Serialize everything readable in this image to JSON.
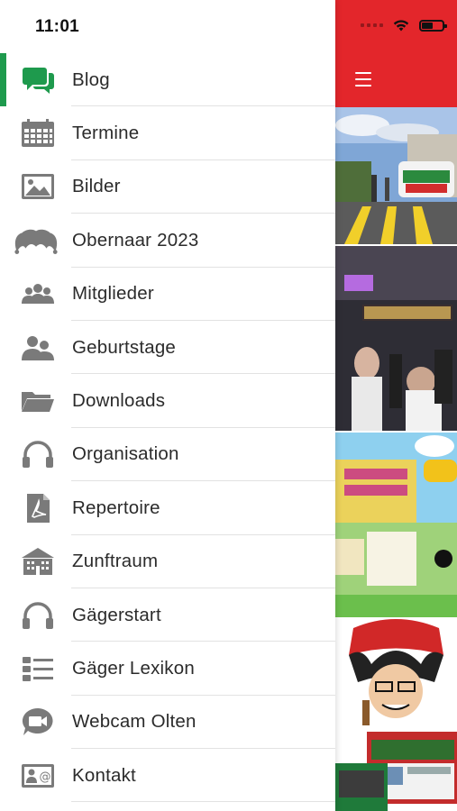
{
  "status_bar": {
    "time": "11:01"
  },
  "colors": {
    "accent_green": "#1e9a4d",
    "header_red": "#e3262b",
    "icon_gray": "#7a7a7a"
  },
  "menu": {
    "items": [
      {
        "label": "Blog",
        "icon": "chat-bubbles-icon",
        "active": true
      },
      {
        "label": "Termine",
        "icon": "calendar-icon"
      },
      {
        "label": "Bilder",
        "icon": "picture-icon"
      },
      {
        "label": "Obernaar 2023",
        "icon": "jester-hat-icon"
      },
      {
        "label": "Mitglieder",
        "icon": "group-icon"
      },
      {
        "label": "Geburtstage",
        "icon": "two-persons-icon"
      },
      {
        "label": "Downloads",
        "icon": "folder-icon"
      },
      {
        "label": "Organisation",
        "icon": "headphones-icon"
      },
      {
        "label": "Repertoire",
        "icon": "pdf-icon"
      },
      {
        "label": "Zunftraum",
        "icon": "building-icon"
      },
      {
        "label": "Gägerstart",
        "icon": "headphones-icon"
      },
      {
        "label": "Gäger Lexikon",
        "icon": "list-icon"
      },
      {
        "label": "Webcam Olten",
        "icon": "video-camera-icon"
      },
      {
        "label": "Kontakt",
        "icon": "contact-card-icon"
      }
    ]
  },
  "background_content": {
    "header_icon": "hamburger-menu-icon",
    "thumbnails": [
      "photo-street-festival",
      "photo-party-crowd",
      "photo-event-poster",
      "photo-mascot-caricature",
      "photo-website-collage"
    ]
  }
}
